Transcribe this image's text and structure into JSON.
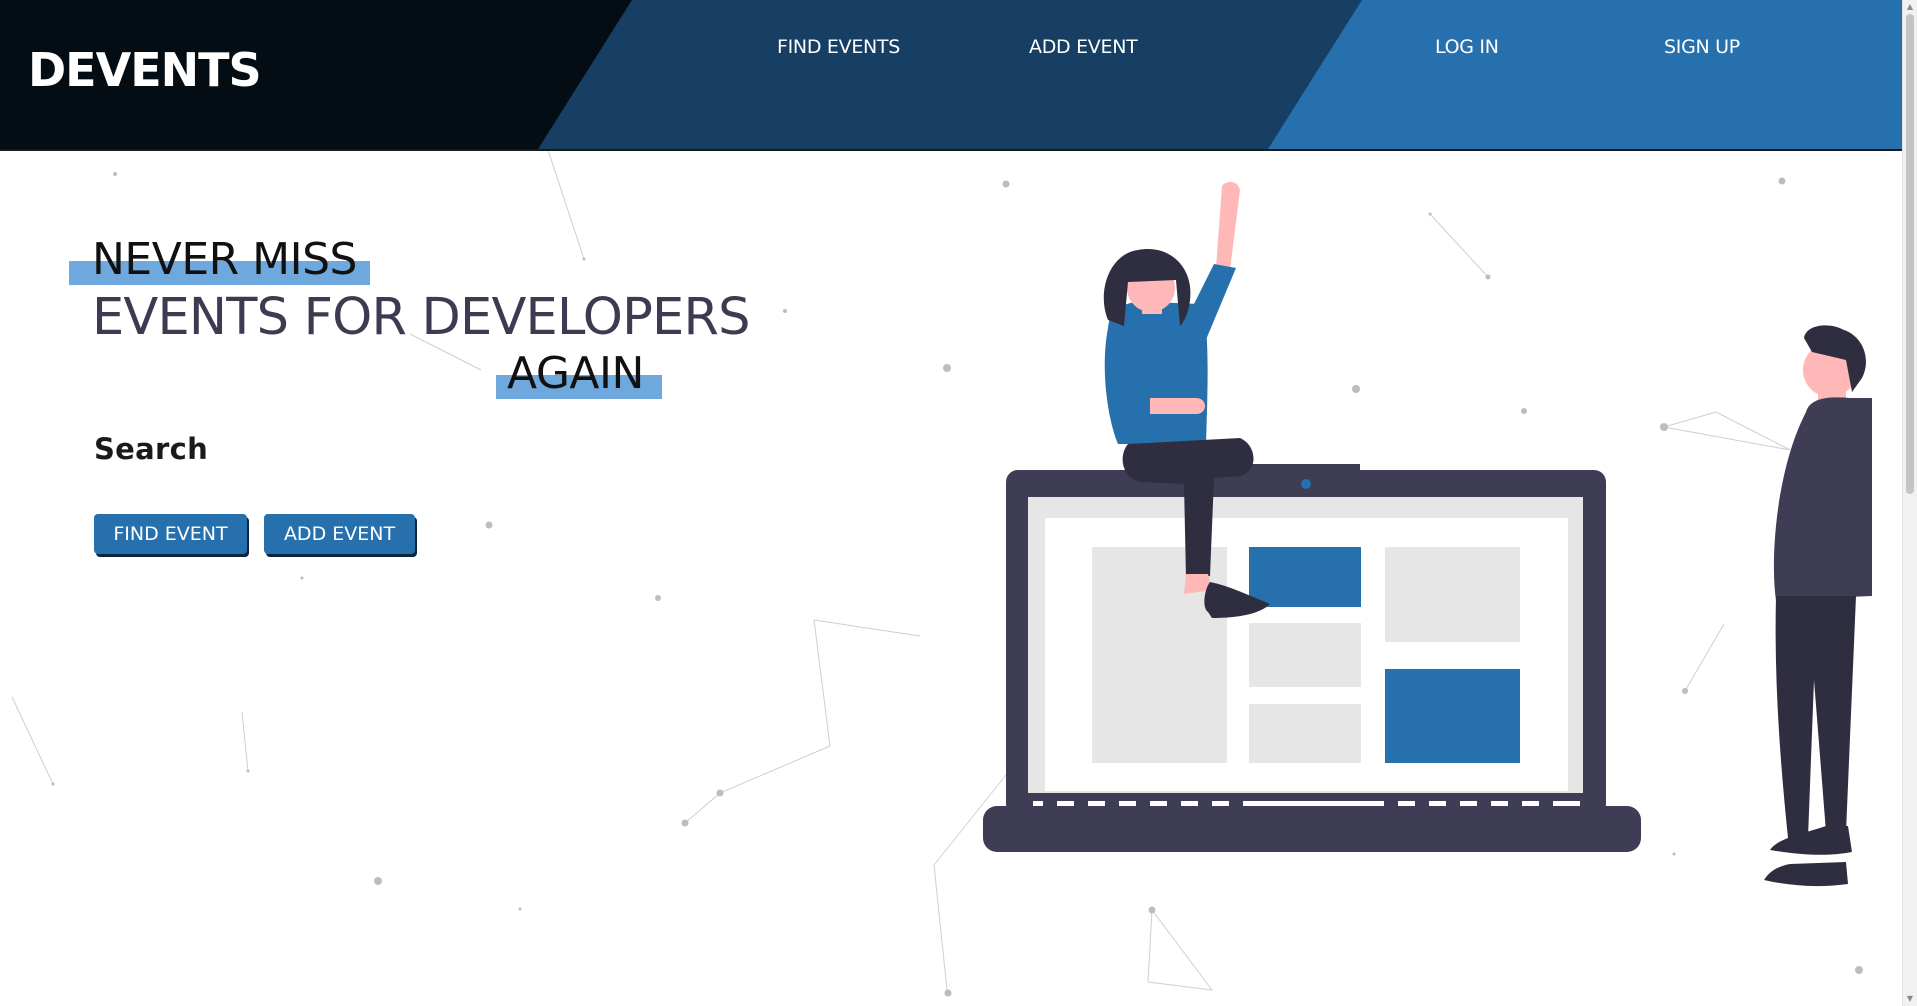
{
  "header": {
    "logo": "DEVENTS",
    "nav": {
      "find_events": "FIND EVENTS",
      "add_event": "ADD EVENT",
      "log_in": "LOG IN",
      "sign_up": "SIGN UP"
    }
  },
  "hero": {
    "line1": "NEVER MISS",
    "line2": "EVENTS FOR DEVELOPERS",
    "line3": "AGAIN",
    "search_heading": "Search",
    "buttons": {
      "find_event": "FIND EVENT",
      "add_event": "ADD EVENT"
    }
  },
  "colors": {
    "header_dark": "#050d14",
    "header_mid": "#163f63",
    "header_light": "#2670ad",
    "accent": "#2670ad",
    "highlight": "#6ea8dc",
    "text_dark": "#3d3b52"
  },
  "icons": {
    "illustration": "woman-sitting-on-laptop-and-man-standing",
    "scroll_up": "chevron-up-icon",
    "scroll_down": "chevron-down-icon"
  }
}
